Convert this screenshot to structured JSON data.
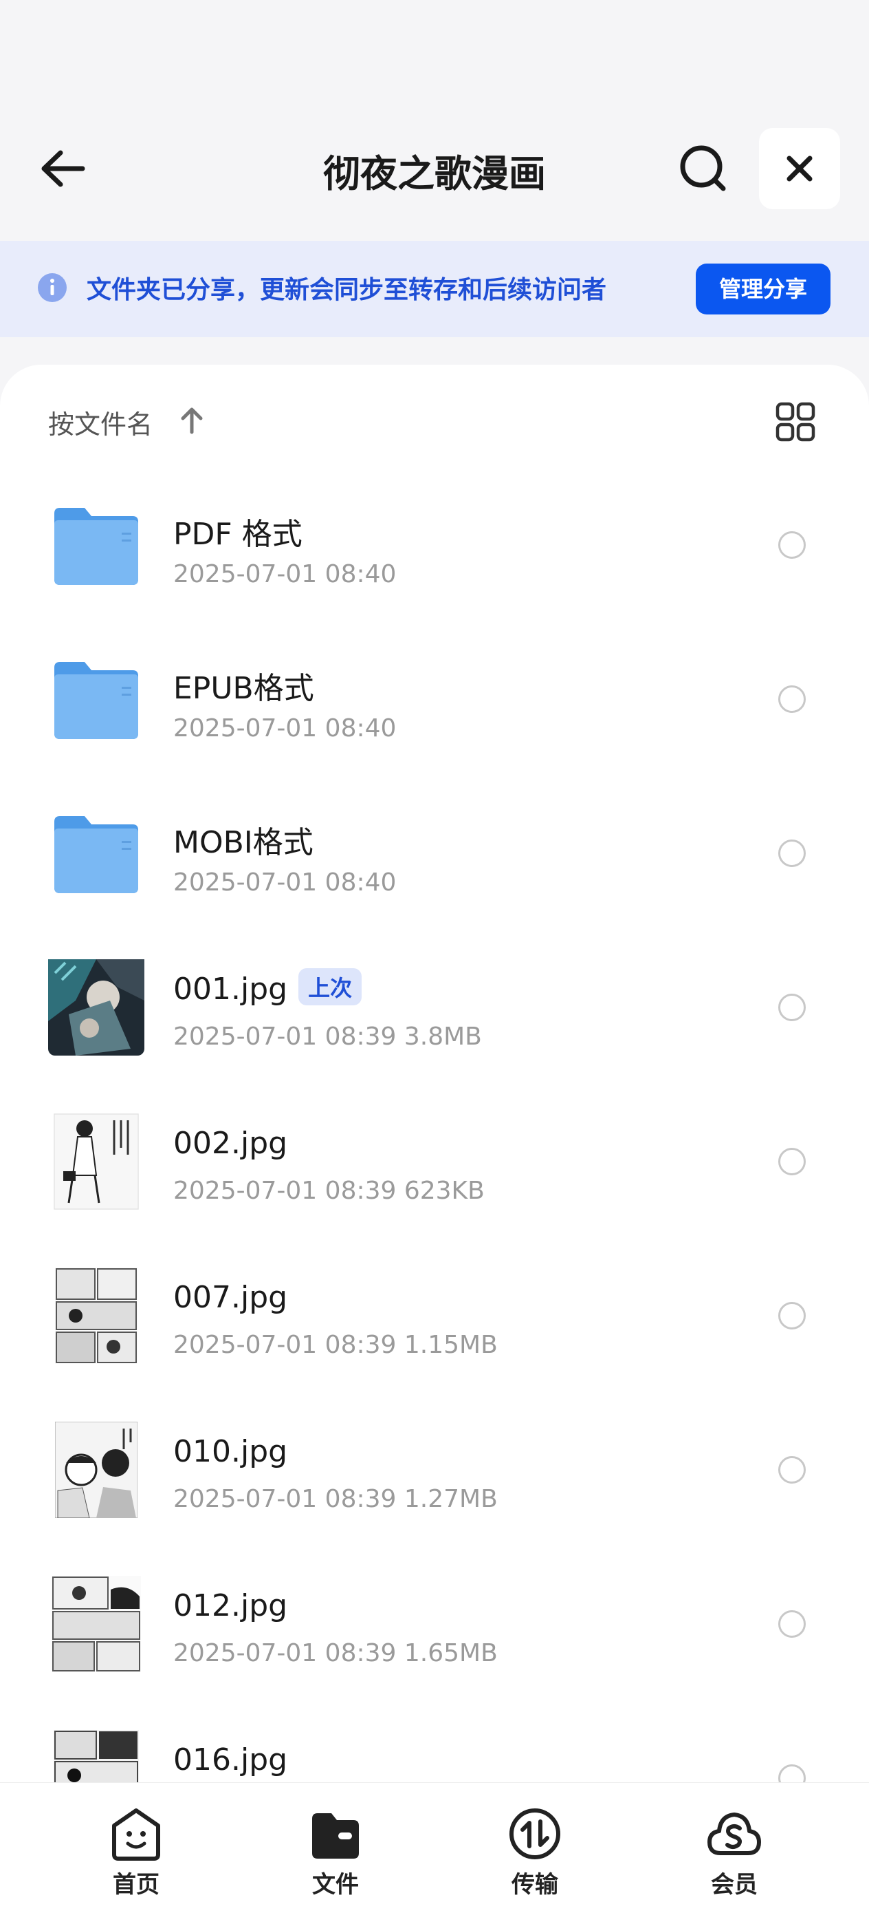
{
  "header": {
    "title": "彻夜之歌漫画"
  },
  "banner": {
    "text": "文件夹已分享，更新会同步至转存和后续访问者",
    "manage_label": "管理分享"
  },
  "sort": {
    "label": "按文件名"
  },
  "files": [
    {
      "name": "PDF 格式",
      "meta": "2025-07-01 08:40",
      "type": "folder"
    },
    {
      "name": "EPUB格式",
      "meta": "2025-07-01 08:40",
      "type": "folder"
    },
    {
      "name": "MOBI格式",
      "meta": "2025-07-01 08:40",
      "type": "folder"
    },
    {
      "name": "001.jpg",
      "badge": "上次",
      "meta": "2025-07-01 08:39  3.8MB",
      "type": "image"
    },
    {
      "name": "002.jpg",
      "meta": "2025-07-01 08:39  623KB",
      "type": "image"
    },
    {
      "name": "007.jpg",
      "meta": "2025-07-01 08:39  1.15MB",
      "type": "image"
    },
    {
      "name": "010.jpg",
      "meta": "2025-07-01 08:39  1.27MB",
      "type": "image"
    },
    {
      "name": "012.jpg",
      "meta": "2025-07-01 08:39  1.65MB",
      "type": "image"
    },
    {
      "name": "016.jpg",
      "meta": "",
      "type": "image"
    }
  ],
  "nav": [
    {
      "label": "首页",
      "icon": "home-smile-icon"
    },
    {
      "label": "文件",
      "icon": "folder-files-icon"
    },
    {
      "label": "传输",
      "icon": "transfer-icon"
    },
    {
      "label": "会员",
      "icon": "vip-cloud-icon"
    }
  ],
  "colors": {
    "accent": "#0b57f0",
    "banner_bg": "#e8ecfb",
    "folder": "#6aaef0"
  }
}
